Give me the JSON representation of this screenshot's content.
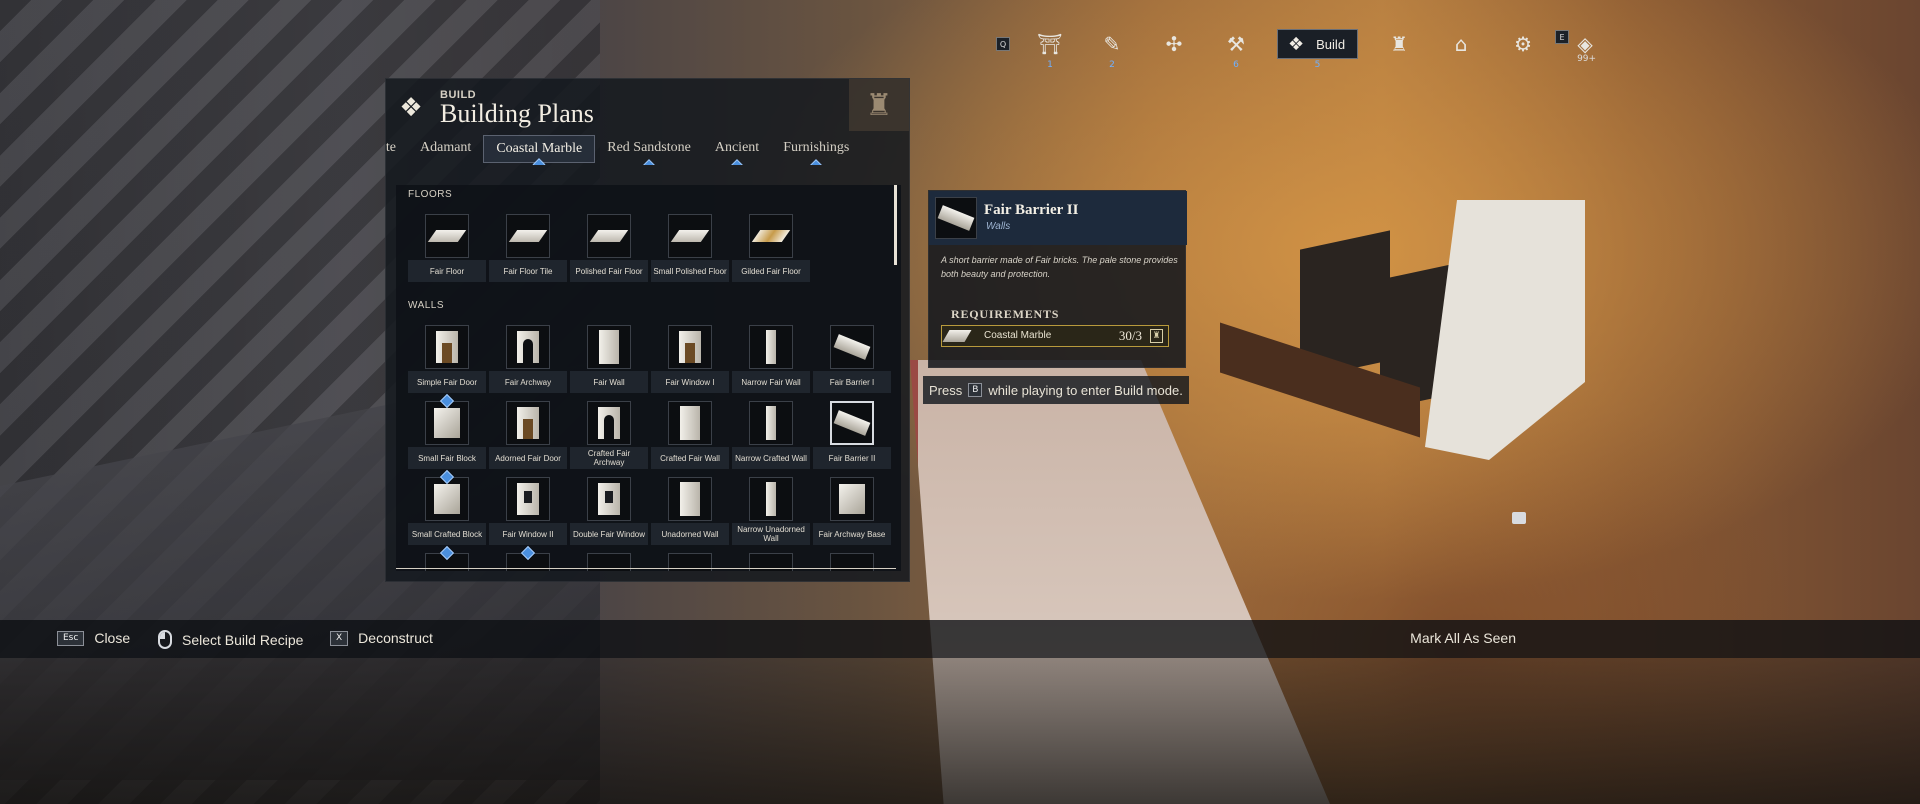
{
  "hud": {
    "items": [
      {
        "icon": "search-icon",
        "glyph": "Q",
        "badge": ""
      },
      {
        "icon": "gate-icon",
        "glyph": "⛩",
        "badge": "1"
      },
      {
        "icon": "telescope-icon",
        "glyph": "✎",
        "badge": "2"
      },
      {
        "icon": "compass-icon",
        "glyph": "✣",
        "badge": ""
      },
      {
        "icon": "crafting-icon",
        "glyph": "⚒",
        "badge": "6"
      }
    ],
    "build": {
      "label": "Build",
      "badge": "5"
    },
    "right_items": [
      {
        "icon": "castle-icon",
        "glyph": "♜"
      },
      {
        "icon": "door-icon",
        "glyph": "⌂"
      },
      {
        "icon": "gear-icon",
        "glyph": "⚙"
      }
    ],
    "key_e": "E",
    "notifications": "99+"
  },
  "panel": {
    "kicker": "BUILD",
    "title": "Building Plans",
    "tabs": [
      {
        "label": "ite",
        "cut": true,
        "badge": false
      },
      {
        "label": "Adamant",
        "badge": false
      },
      {
        "label": "Coastal Marble",
        "active": true,
        "badge": true
      },
      {
        "label": "Red Sandstone",
        "badge": true
      },
      {
        "label": "Ancient",
        "badge": true
      },
      {
        "label": "Furnishings",
        "badge": true
      }
    ],
    "sections": {
      "floors": "FLOORS",
      "walls": "WALLS"
    },
    "floors": [
      {
        "label": "Fair Floor",
        "shape": "floor"
      },
      {
        "label": "Fair Floor Tile",
        "shape": "floor"
      },
      {
        "label": "Polished Fair Floor",
        "shape": "floor"
      },
      {
        "label": "Small Polished Floor",
        "shape": "floor"
      },
      {
        "label": "Gilded Fair Floor",
        "shape": "gilded"
      }
    ],
    "walls": [
      {
        "label": "Simple Fair Door",
        "shape": "door"
      },
      {
        "label": "Fair Archway",
        "shape": "arch"
      },
      {
        "label": "Fair Wall",
        "shape": "wall"
      },
      {
        "label": "Fair Window I",
        "shape": "door"
      },
      {
        "label": "Narrow Fair Wall",
        "shape": "narrow"
      },
      {
        "label": "Fair Barrier I",
        "shape": "barrier"
      },
      {
        "label": "Small Fair Block",
        "shape": "block",
        "badge": true
      },
      {
        "label": "Adorned Fair Door",
        "shape": "door"
      },
      {
        "label": "Crafted Fair Archway",
        "shape": "arch"
      },
      {
        "label": "Crafted Fair Wall",
        "shape": "wall"
      },
      {
        "label": "Narrow Crafted Wall",
        "shape": "narrow"
      },
      {
        "label": "Fair Barrier II",
        "shape": "barrier",
        "selected": true
      },
      {
        "label": "Small Crafted Block",
        "shape": "block",
        "badge": true
      },
      {
        "label": "Fair Window II",
        "shape": "window"
      },
      {
        "label": "Double Fair Window",
        "shape": "window"
      },
      {
        "label": "Unadorned Wall",
        "shape": "wall"
      },
      {
        "label": "Narrow Unadorned Wall",
        "shape": "narrow"
      },
      {
        "label": "Fair Archway Base",
        "shape": "block"
      }
    ],
    "partial_row_badges": [
      true,
      true,
      false,
      false,
      false,
      false
    ]
  },
  "detail": {
    "name": "Fair Barrier II",
    "category": "Walls",
    "description": "A short barrier made of Fair bricks. The pale stone provides both beauty and protection.",
    "requirements_title": "REQUIREMENTS",
    "requirement": {
      "name": "Coastal Marble",
      "quantity": "30/3"
    }
  },
  "hint": {
    "before": "Press",
    "key": "B",
    "after": "while playing to enter Build mode."
  },
  "bottom_bar": {
    "close": {
      "key": "Esc",
      "label": "Close"
    },
    "select": {
      "label": "Select Build Recipe"
    },
    "deconstruct": {
      "key": "X",
      "label": "Deconstruct"
    },
    "mark_all": "Mark All As Seen"
  },
  "colors": {
    "accent_badge": "#4a8fde",
    "requirement_border": "#b89a3c"
  }
}
